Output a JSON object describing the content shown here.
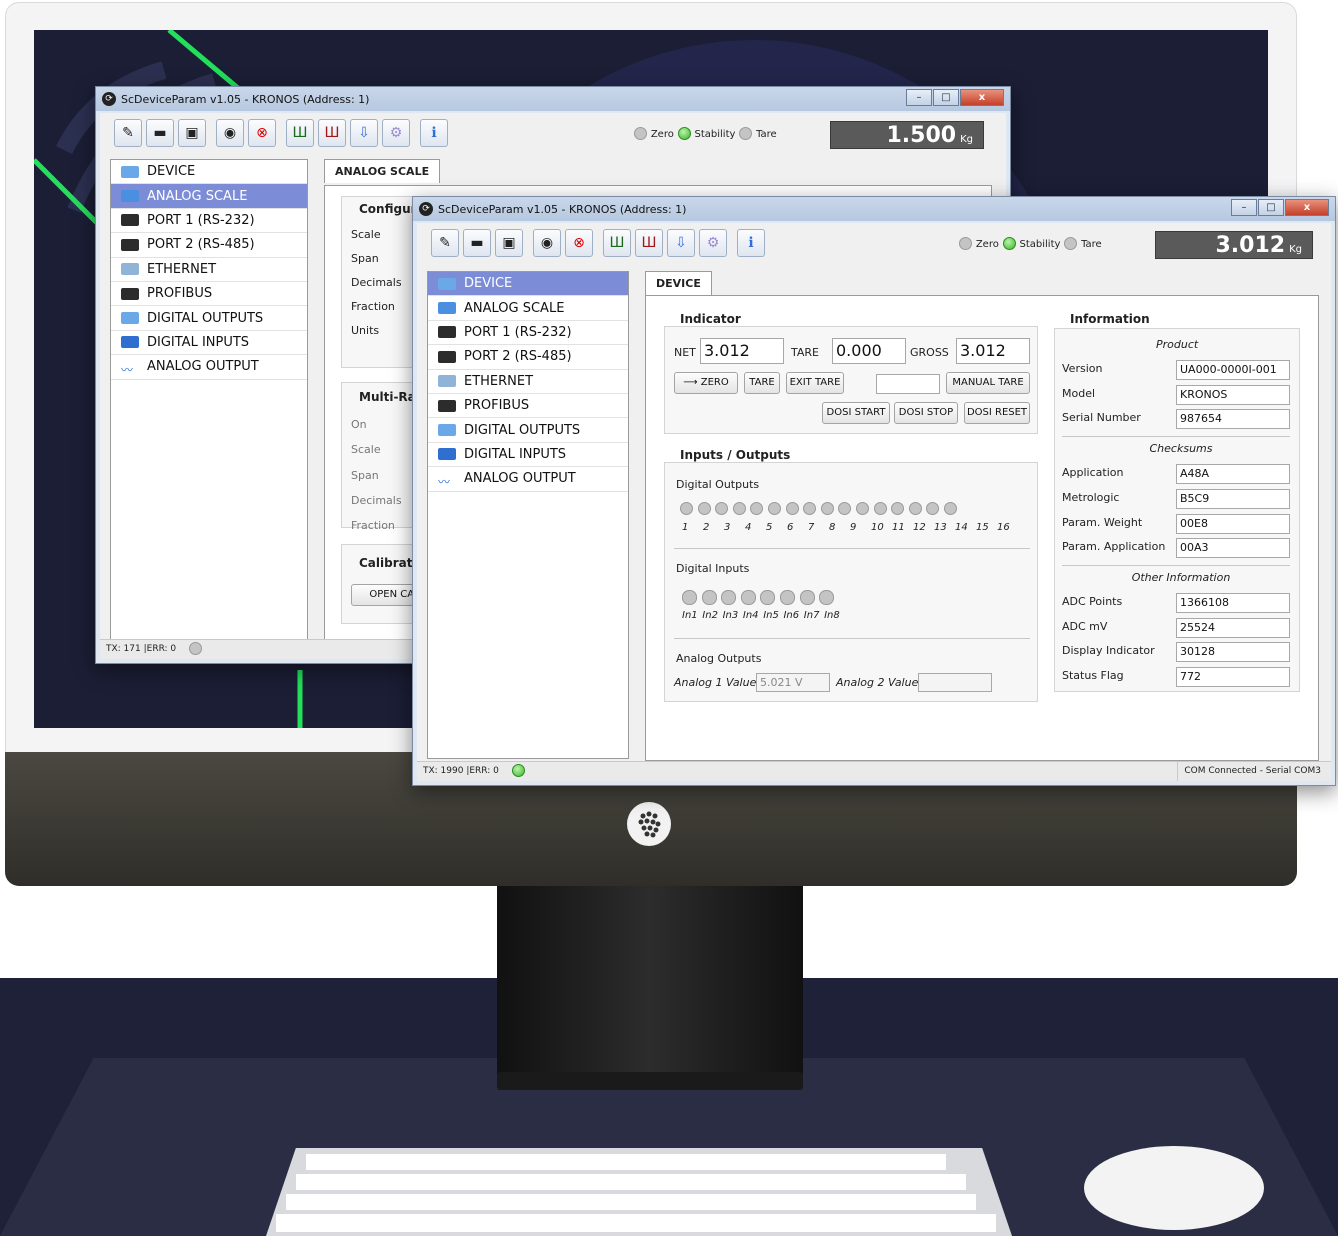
{
  "back_window": {
    "title": "ScDeviceParam v1.05 - KRONOS (Address: 1)",
    "controls": {
      "minimize": "–",
      "maximize": "□",
      "close": "x"
    },
    "status_leds": {
      "zero": "Zero",
      "stability": "Stability",
      "tare": "Tare"
    },
    "weight": {
      "value": "1.500",
      "unit": "Kg"
    },
    "tree": [
      "DEVICE",
      "ANALOG SCALE",
      "PORT 1 (RS-232)",
      "PORT 2 (RS-485)",
      "ETHERNET",
      "PROFIBUS",
      "DIGITAL OUTPUTS",
      "DIGITAL INPUTS",
      "ANALOG OUTPUT"
    ],
    "tab": "ANALOG SCALE",
    "config_title": "Configura",
    "config_labels": [
      "Scale",
      "Span",
      "Decimals",
      "Fraction",
      "Units"
    ],
    "multirange_title": "Multi-Ran",
    "multirange_labels": [
      "On",
      "Scale",
      "Span",
      "Decimals",
      "Fraction"
    ],
    "calibration_title": "Calibratio",
    "calibration_button": "OPEN CALI",
    "status": "TX: 171  |ERR: 0"
  },
  "front_window": {
    "title": "ScDeviceParam v1.05 - KRONOS (Address: 1)",
    "controls": {
      "minimize": "–",
      "maximize": "□",
      "close": "x"
    },
    "status_leds": {
      "zero": "Zero",
      "stability": "Stability",
      "tare": "Tare"
    },
    "weight": {
      "value": "3.012",
      "unit": "Kg"
    },
    "tree": [
      "DEVICE",
      "ANALOG SCALE",
      "PORT 1 (RS-232)",
      "PORT 2 (RS-485)",
      "ETHERNET",
      "PROFIBUS",
      "DIGITAL OUTPUTS",
      "DIGITAL INPUTS",
      "ANALOG OUTPUT"
    ],
    "tab": "DEVICE",
    "indicator": {
      "title": "Indicator",
      "net_label": "NET",
      "net_value": "3.012",
      "tare_label": "TARE",
      "tare_value": "0.000",
      "gross_label": "GROSS",
      "gross_value": "3.012",
      "buttons": {
        "zero": "ZERO",
        "tare": "TARE",
        "exit_tare": "EXIT TARE",
        "manual_tare": "MANUAL TARE",
        "dosi_start": "DOSI START",
        "dosi_stop": "DOSI STOP",
        "dosi_reset": "DOSI RESET"
      },
      "manual_tare_value": ""
    },
    "io": {
      "title": "Inputs / Outputs",
      "digital_outputs_label": "Digital Outputs",
      "digital_outputs": [
        "1",
        "2",
        "3",
        "4",
        "5",
        "6",
        "7",
        "8",
        "9",
        "10",
        "11",
        "12",
        "13",
        "14",
        "15",
        "16"
      ],
      "digital_inputs_label": "Digital Inputs",
      "digital_inputs": [
        "In1",
        "In2",
        "In3",
        "In4",
        "In5",
        "In6",
        "In7",
        "In8"
      ],
      "analog_outputs_label": "Analog Outputs",
      "analog1_label": "Analog 1 Value",
      "analog1_value": "5.021 V",
      "analog2_label": "Analog 2 Value",
      "analog2_value": ""
    },
    "information": {
      "title": "Information",
      "product_title": "Product",
      "product": [
        {
          "label": "Version",
          "value": "UA000-0000I-001"
        },
        {
          "label": "Model",
          "value": "KRONOS"
        },
        {
          "label": "Serial Number",
          "value": "987654"
        }
      ],
      "checksums_title": "Checksums",
      "checksums": [
        {
          "label": "Application",
          "value": "A48A"
        },
        {
          "label": "Metrologic",
          "value": "B5C9"
        },
        {
          "label": "Param. Weight",
          "value": "00E8"
        },
        {
          "label": "Param. Application",
          "value": "00A3"
        }
      ],
      "other_title": "Other Information",
      "other": [
        {
          "label": "ADC Points",
          "value": "1366108"
        },
        {
          "label": "ADC mV",
          "value": "25524"
        },
        {
          "label": "Display Indicator",
          "value": " 30128"
        },
        {
          "label": "Status Flag",
          "value": "772"
        }
      ]
    },
    "status": "TX: 1990  |ERR: 0",
    "connection": "COM Connected - Serial COM3"
  },
  "colors": {
    "selection": "#7d8cd6",
    "led_on": "#3bb42a",
    "weight_bg": "#5a5a5a",
    "screen_bg": "#1b1e35"
  }
}
